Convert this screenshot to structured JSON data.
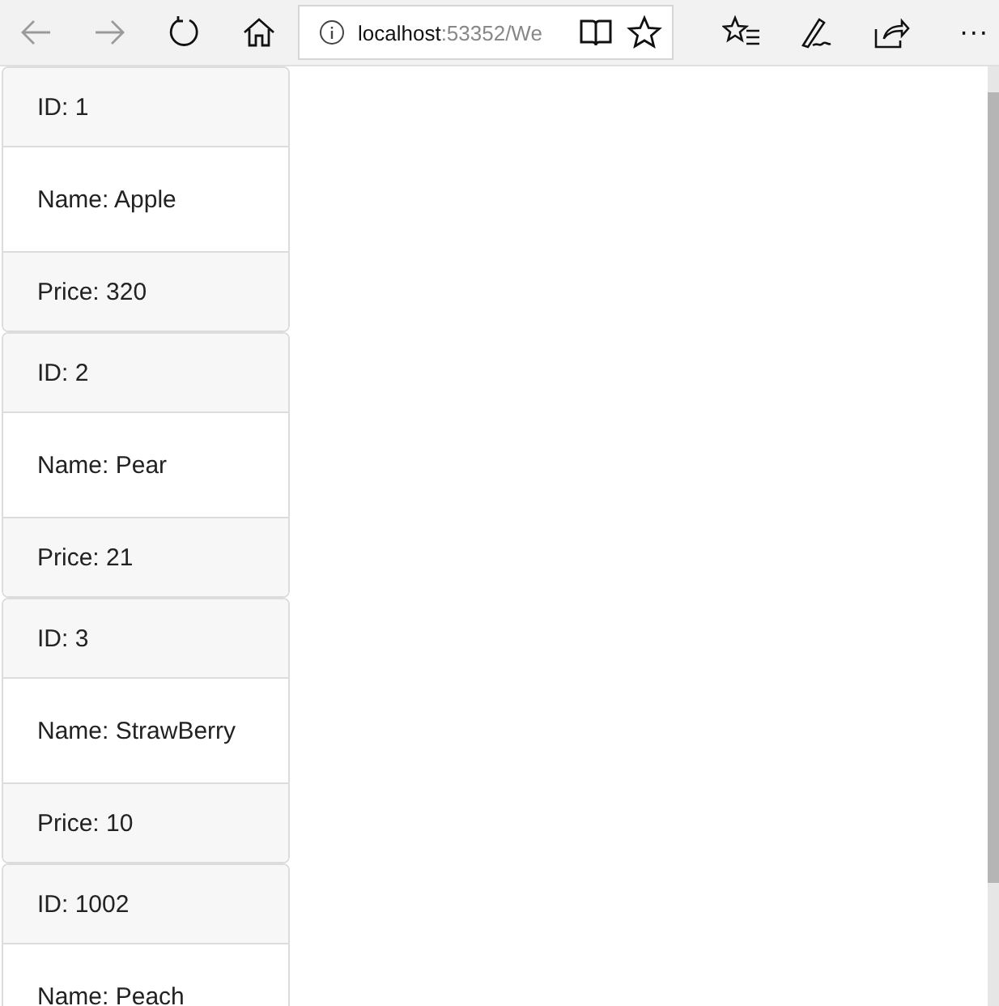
{
  "toolbar": {
    "nav_buttons": [
      {
        "kind": "back",
        "disabled": true
      },
      {
        "kind": "forward",
        "disabled": true
      },
      {
        "kind": "refresh",
        "disabled": false
      },
      {
        "kind": "home",
        "disabled": false
      }
    ],
    "address": {
      "host": "localhost",
      "rest": ":53352/We"
    },
    "more": "···"
  },
  "products": [
    {
      "id": "ID: 1",
      "name": "Name: Apple",
      "price": "Price: 320"
    },
    {
      "id": "ID: 2",
      "name": "Name: Pear",
      "price": "Price: 21"
    },
    {
      "id": "ID: 3",
      "name": "Name: StrawBerry",
      "price": "Price: 10"
    },
    {
      "id": "ID: 1002",
      "name": "Name: Peach"
    }
  ]
}
